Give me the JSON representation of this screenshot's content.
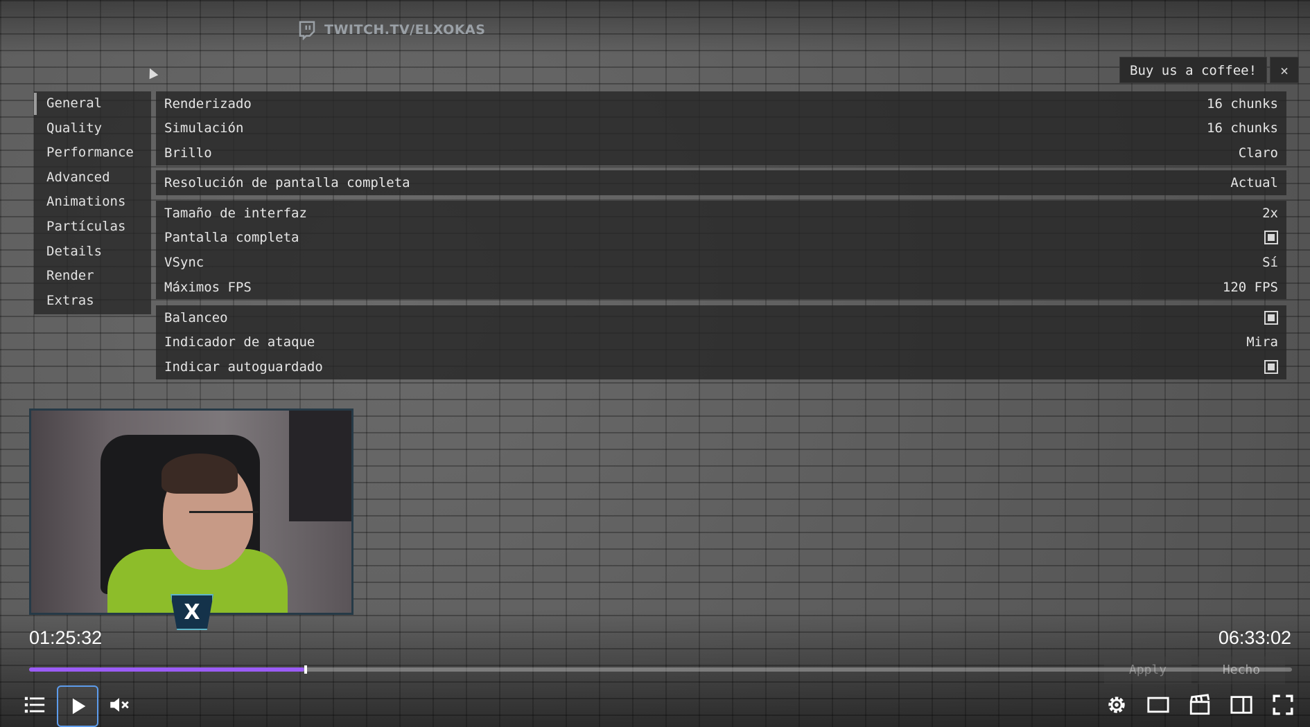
{
  "stream": {
    "channel_label": "TWITCH.TV/ELXOKAS"
  },
  "banner": {
    "coffee_label": "Buy us a coffee!",
    "close_label": "×"
  },
  "sidebar": {
    "items": [
      {
        "label": "General",
        "active": true
      },
      {
        "label": "Quality"
      },
      {
        "label": "Performance"
      },
      {
        "label": "Advanced"
      },
      {
        "label": "Animations"
      },
      {
        "label": "Partículas"
      },
      {
        "label": "Details"
      },
      {
        "label": "Render"
      },
      {
        "label": "Extras"
      }
    ]
  },
  "settings": {
    "group1": [
      {
        "label": "Renderizado",
        "value": "16 chunks"
      },
      {
        "label": "Simulación",
        "value": "16 chunks"
      },
      {
        "label": "Brillo",
        "value": "Claro"
      }
    ],
    "group2": [
      {
        "label": "Resolución de pantalla completa",
        "value": "Actual"
      }
    ],
    "group3": [
      {
        "label": "Tamaño de interfaz",
        "value": "2x"
      },
      {
        "label": "Pantalla completa",
        "checkbox": true
      },
      {
        "label": "VSync",
        "value": "Sí"
      },
      {
        "label": "Máximos FPS",
        "value": "120 FPS"
      }
    ],
    "group4": [
      {
        "label": "Balanceo",
        "checkbox": true
      },
      {
        "label": "Indicador de ataque",
        "value": "Mira"
      },
      {
        "label": "Indicar autoguardado",
        "checkbox": true
      }
    ]
  },
  "menu_buttons": {
    "apply_label": "Apply",
    "done_label": "Hecho"
  },
  "player": {
    "current_time": "01:25:32",
    "duration": "06:33:02",
    "progress": 0.218,
    "accent_color": "#9b5cf6"
  },
  "webcam": {
    "logo_glyph": "X"
  }
}
